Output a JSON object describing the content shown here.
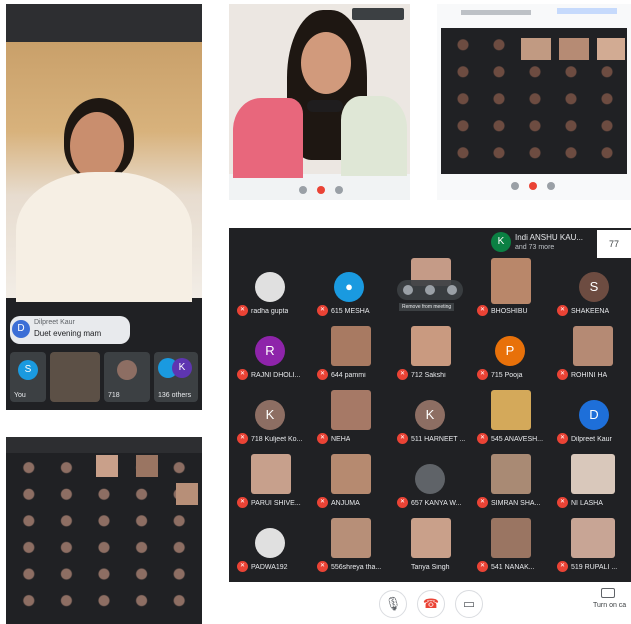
{
  "panel_a": {
    "chat_initial": "D",
    "chat_name": "Dilpreet Kaur",
    "chat_message": "Duet evening mam",
    "tiles": [
      {
        "initial": "S",
        "label": "You",
        "color": "#1a9ae0"
      },
      {
        "initial": "",
        "label": "",
        "color": ""
      },
      {
        "initial": "",
        "label": "718",
        "color": "#7a5b4a"
      },
      {
        "initial": "K",
        "label": "136 others",
        "color": "#1a9ae0"
      }
    ]
  },
  "panel_e": {
    "header_initial": "K",
    "header_line1": "Indi ANSHU KAU...",
    "header_line2": "and 73 more",
    "header_count": "77",
    "tooltip": "Remove from meeting",
    "participants": [
      {
        "name": "radha gupta",
        "initial": "",
        "color": "#e0e0e0",
        "kind": "photo"
      },
      {
        "name": "615 MESHA",
        "initial": "",
        "color": "#1a9ae0",
        "kind": "avatar"
      },
      {
        "name": "",
        "initial": "",
        "color": "#c59b87",
        "kind": "video"
      },
      {
        "name": "BHOSHIBU",
        "initial": "",
        "color": "#b9876a",
        "kind": "video"
      },
      {
        "name": "SHAKEENA",
        "initial": "S",
        "color": "#6d4c41",
        "kind": "letter"
      },
      {
        "name": "RAJNI DHOLI...",
        "initial": "R",
        "color": "#8e24aa",
        "kind": "letter"
      },
      {
        "name": "644 pammi",
        "initial": "",
        "color": "#a87a62",
        "kind": "video"
      },
      {
        "name": "712 Sakshi",
        "initial": "",
        "color": "#c99a80",
        "kind": "video"
      },
      {
        "name": "715 Pooja",
        "initial": "P",
        "color": "#e8710a",
        "kind": "letter"
      },
      {
        "name": "ROHINI HA",
        "initial": "",
        "color": "#b58a74",
        "kind": "video"
      },
      {
        "name": "718 Kuljeet Ko...",
        "initial": "K",
        "color": "#8d6e63",
        "kind": "letter"
      },
      {
        "name": "NEHA",
        "initial": "",
        "color": "#a67966",
        "kind": "video"
      },
      {
        "name": "511 HARNEET ...",
        "initial": "K",
        "color": "#8d6e63",
        "kind": "letter"
      },
      {
        "name": "545 ANAVESH...",
        "initial": "",
        "color": "#d4a95a",
        "kind": "video"
      },
      {
        "name": "Dilpreet Kaur",
        "initial": "D",
        "color": "#1e6fd9",
        "kind": "letter"
      },
      {
        "name": "PARUI SHIVE...",
        "initial": "",
        "color": "#c7a08c",
        "kind": "video"
      },
      {
        "name": "ANJUMA",
        "initial": "",
        "color": "#b68a70",
        "kind": "video"
      },
      {
        "name": "657 KANYA W...",
        "initial": "",
        "color": "#5f6368",
        "kind": "photo"
      },
      {
        "name": "SIMRAN SHA...",
        "initial": "",
        "color": "#a98a74",
        "kind": "video"
      },
      {
        "name": "NI LASHA",
        "initial": "",
        "color": "#d9c8bb",
        "kind": "video"
      },
      {
        "name": "PADWA192",
        "initial": "",
        "color": "#e0e0e0",
        "kind": "photo"
      },
      {
        "name": "556shreya tha...",
        "initial": "",
        "color": "#b78f78",
        "kind": "video"
      },
      {
        "name": "Tanya Singh",
        "initial": "",
        "color": "#c9a08a",
        "kind": "video"
      },
      {
        "name": "541 NANAK...",
        "initial": "",
        "color": "#9a7562",
        "kind": "video"
      },
      {
        "name": "519 RUPALI ...",
        "initial": "",
        "color": "#c8a595",
        "kind": "video"
      }
    ],
    "caption_label": "Turn on ca"
  },
  "colors": {
    "meet_dark": "#202124",
    "tile": "#3c4043",
    "mic_off": "#ea4335",
    "hangup": "#ea4335"
  }
}
